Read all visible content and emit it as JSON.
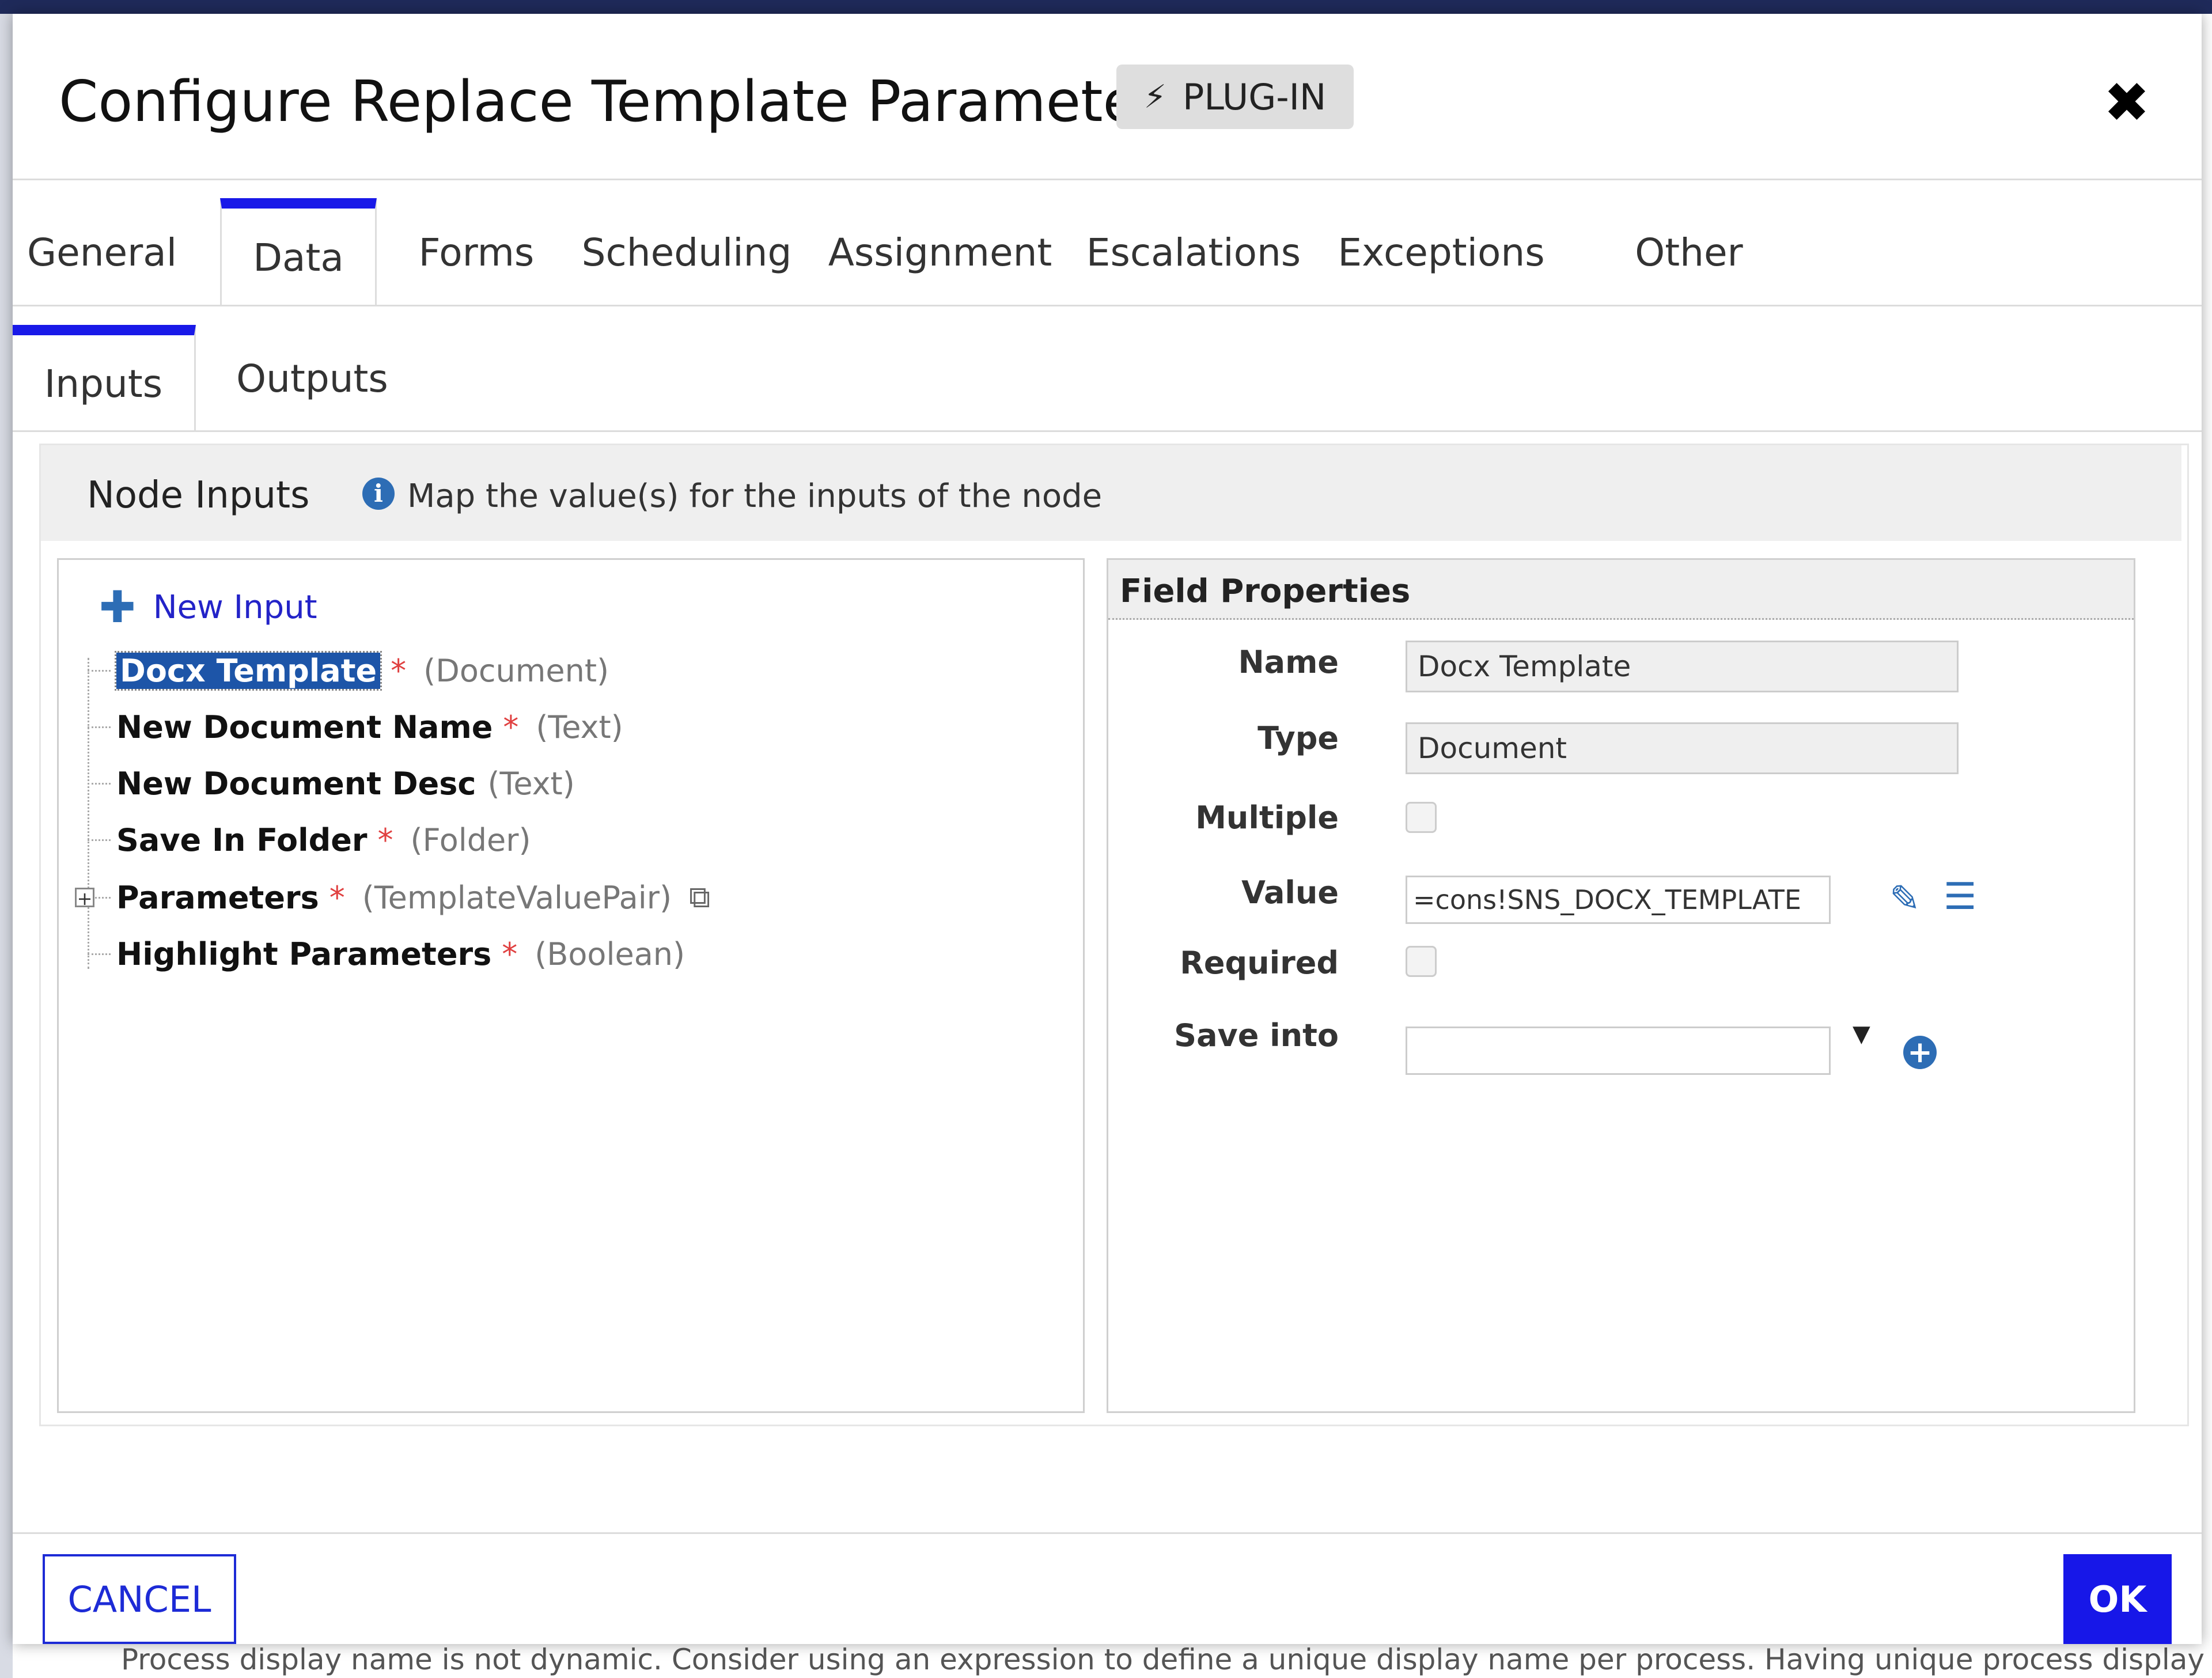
{
  "dialog": {
    "title": "Configure Replace Template Parameter",
    "badge_label": "PLUG-IN",
    "close_glyph": "✖"
  },
  "tabs": [
    "General",
    "Data",
    "Forms",
    "Scheduling",
    "Assignment",
    "Escalations",
    "Exceptions",
    "Other"
  ],
  "active_tab": "Data",
  "subtabs": [
    "Inputs",
    "Outputs"
  ],
  "active_subtab": "Inputs",
  "node_inputs": {
    "title": "Node Inputs",
    "hint": "Map the value(s) for the inputs of the node",
    "new_input_label": "New Input",
    "items": [
      {
        "name": "Docx Template",
        "required": "*",
        "type": "(Document)"
      },
      {
        "name": "New Document Name",
        "required": "*",
        "type": "(Text)"
      },
      {
        "name": "New Document Desc",
        "required": "",
        "type": "(Text)"
      },
      {
        "name": "Save In Folder",
        "required": "*",
        "type": "(Folder)"
      },
      {
        "name": "Parameters",
        "required": "*",
        "type": "(TemplateValuePair)"
      },
      {
        "name": "Highlight Parameters",
        "required": "*",
        "type": "(Boolean)"
      }
    ]
  },
  "field_properties": {
    "title": "Field Properties",
    "labels": {
      "name": "Name",
      "type": "Type",
      "multiple": "Multiple",
      "value": "Value",
      "required": "Required",
      "save_into": "Save into"
    },
    "name_value": "Docx Template",
    "type_value": "Document",
    "multiple_checked": false,
    "value_expression": "=cons!SNS_DOCX_TEMPLATE",
    "required_checked": false,
    "save_into_value": ""
  },
  "footer": {
    "cancel_label": "CANCEL",
    "ok_label": "OK"
  },
  "background": {
    "bottom_text": "Process display name is not dynamic. Consider using an expression to define a unique display name per process. Having unique process display n"
  },
  "colors": {
    "accent": "#1717e8",
    "link": "#2323c8",
    "icon_blue": "#2d6db5",
    "required_star": "#e04040",
    "selected_bg": "#1d55a8"
  },
  "icons": {
    "plugin": "plug-icon",
    "close": "close-icon",
    "info": "info-icon",
    "add": "plus-icon",
    "copy": "copy-icon",
    "edit": "edit-icon",
    "list": "list-icon",
    "add_circle": "add-circle-icon",
    "expand": "expand-icon"
  }
}
